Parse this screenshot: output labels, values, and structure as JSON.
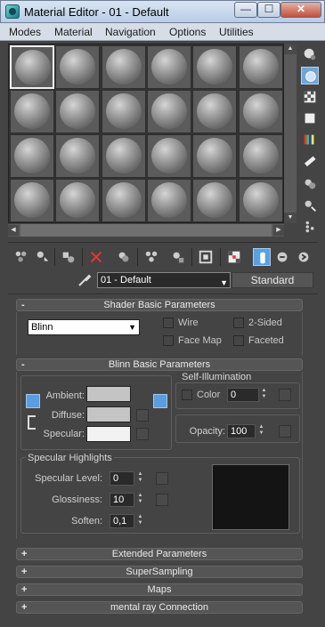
{
  "window": {
    "title": "Material Editor - 01 - Default",
    "controls": {
      "minimize": "—",
      "maximize": "☐",
      "close": "✕"
    }
  },
  "menu": [
    "Modes",
    "Material",
    "Navigation",
    "Options",
    "Utilities"
  ],
  "sample_slots": {
    "rows": 4,
    "cols": 6,
    "active_index": 0
  },
  "side_toolbar": [
    {
      "icon": "sample-type-sphere-icon",
      "active": false
    },
    {
      "icon": "backlight-icon",
      "active": true
    },
    {
      "icon": "background-checker-icon",
      "active": false
    },
    {
      "icon": "sample-uv-tiling-icon",
      "active": false
    },
    {
      "icon": "video-color-check-icon",
      "active": false
    },
    {
      "icon": "make-preview-icon",
      "active": false
    },
    {
      "icon": "options-icon",
      "active": false
    },
    {
      "icon": "select-by-material-icon",
      "active": false
    },
    {
      "icon": "material-map-navigator-icon",
      "active": false
    }
  ],
  "bottom_toolbar": [
    {
      "icon": "get-material-icon",
      "active": false
    },
    {
      "icon": "put-to-scene-icon",
      "active": false
    },
    {
      "icon": "assign-to-selection-icon",
      "active": false
    },
    {
      "icon": "reset-map-icon",
      "active": false
    },
    {
      "icon": "make-copy-icon",
      "active": false
    },
    {
      "icon": "make-unique-icon",
      "active": false
    },
    {
      "icon": "put-to-library-icon",
      "active": false
    },
    {
      "icon": "material-id-channel-icon",
      "active": false
    },
    {
      "icon": "show-map-in-viewport-icon",
      "active": false
    },
    {
      "icon": "show-end-result-icon",
      "active": true
    },
    {
      "icon": "go-to-parent-icon",
      "active": false
    },
    {
      "icon": "go-forward-to-sibling-icon",
      "active": false
    }
  ],
  "material": {
    "name": "01 - Default",
    "type": "Standard"
  },
  "shader_basic": {
    "header": "Shader Basic Parameters",
    "sign": "-",
    "shader": "Blinn",
    "options": {
      "wire": "Wire",
      "two_sided": "2-Sided",
      "face_map": "Face Map",
      "faceted": "Faceted"
    }
  },
  "blinn_basic": {
    "header": "Blinn Basic Parameters",
    "sign": "-",
    "ambient": "Ambient:",
    "diffuse": "Diffuse:",
    "specular": "Specular:",
    "colors": {
      "ambient": "#c4c4c4",
      "diffuse": "#c4c4c4",
      "specular": "#f2f2f2"
    },
    "self_illumination": {
      "title": "Self-Illumination",
      "color_label": "Color",
      "value": "0"
    },
    "opacity": {
      "label": "Opacity:",
      "value": "100"
    },
    "specular_highlights": {
      "title": "Specular Highlights",
      "level_label": "Specular Level:",
      "level": "0",
      "glossiness_label": "Glossiness:",
      "glossiness": "10",
      "soften_label": "Soften:",
      "soften": "0,1"
    }
  },
  "collapsed_rollouts": [
    {
      "sign": "+",
      "label": "Extended Parameters"
    },
    {
      "sign": "+",
      "label": "SuperSampling"
    },
    {
      "sign": "+",
      "label": "Maps"
    },
    {
      "sign": "+",
      "label": "mental ray Connection"
    }
  ],
  "icons": {
    "scroll_up": "▲",
    "scroll_down": "▼",
    "scroll_left": "◀",
    "scroll_right": "▶",
    "dropdown": "▼",
    "spin_up": "▲",
    "spin_down": "▼"
  },
  "colors": {
    "accent": "#5b9ee0",
    "panel": "#444444",
    "titlebar": "#c8d8ec"
  }
}
